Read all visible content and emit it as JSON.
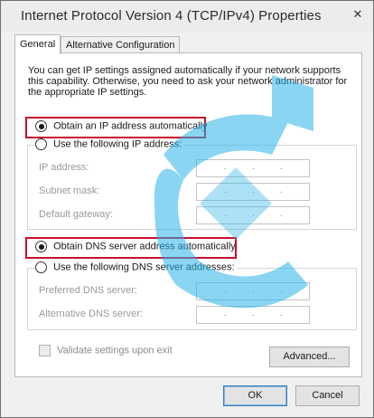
{
  "window": {
    "title": "Internet Protocol Version 4 (TCP/IPv4) Properties",
    "close_glyph": "✕"
  },
  "tabs": [
    {
      "label": "General",
      "active": true
    },
    {
      "label": "Alternative Configuration",
      "active": false
    }
  ],
  "intro_text": "You can get IP settings assigned automatically if your network supports this capability. Otherwise, you need to ask your network administrator for the appropriate IP settings.",
  "ip_section": {
    "auto_label": "Obtain an IP address automatically",
    "manual_label": "Use the following IP address:",
    "selected": "auto",
    "fields": [
      {
        "label": "IP address:",
        "value": ". . ."
      },
      {
        "label": "Subnet mask:",
        "value": ". . ."
      },
      {
        "label": "Default gateway:",
        "value": ". . ."
      }
    ]
  },
  "dns_section": {
    "auto_label": "Obtain DNS server address automatically",
    "manual_label": "Use the following DNS server addresses:",
    "selected": "auto",
    "fields": [
      {
        "label": "Preferred DNS server:",
        "value": ". . ."
      },
      {
        "label": "Alternative DNS server:",
        "value": ". . ."
      }
    ]
  },
  "validate_label": "Validate settings upon exit",
  "buttons": {
    "advanced": "Advanced...",
    "ok": "OK",
    "cancel": "Cancel"
  },
  "colors": {
    "highlight": "#c8102e",
    "watermark": "#2bb3e6"
  },
  "watermark_icon": "logo-watermark"
}
